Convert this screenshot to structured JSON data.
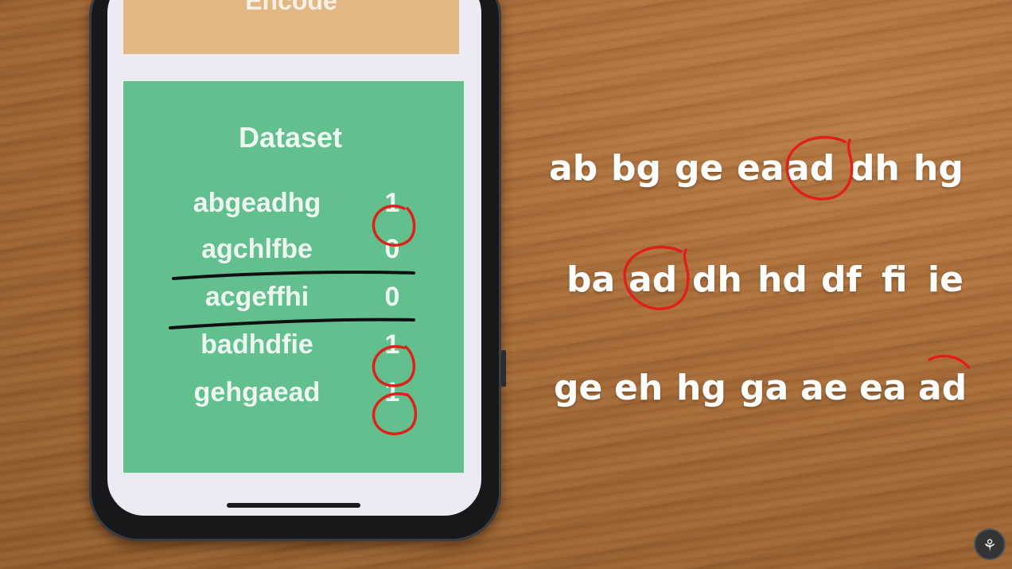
{
  "phone": {
    "encode_button_label": "Encode",
    "dataset_title": "Dataset",
    "rows": [
      {
        "sequence": "abgeadhg",
        "label": "1",
        "circled": true,
        "struck": false
      },
      {
        "sequence": "agchlfbe",
        "label": "0",
        "circled": false,
        "struck": true
      },
      {
        "sequence": "acgeffhi",
        "label": "0",
        "circled": false,
        "struck": true
      },
      {
        "sequence": "badhdfie",
        "label": "1",
        "circled": true,
        "struck": false
      },
      {
        "sequence": "gehgaead",
        "label": "1",
        "circled": true,
        "struck": false
      }
    ]
  },
  "pair_lines": [
    {
      "pairs": [
        "ab",
        "bg",
        "ge",
        "ea",
        "ad",
        "dh",
        "hg"
      ],
      "circled_index": 4
    },
    {
      "pairs": [
        "ba",
        "ad",
        "dh",
        "hd",
        "df",
        "fi",
        "ie"
      ],
      "circled_index": 1
    },
    {
      "pairs": [
        "ge",
        "eh",
        "hg",
        "ga",
        "ae",
        "ea",
        "ad"
      ],
      "circled_index": 6,
      "circle_partial": true
    }
  ],
  "annotation_color": "#e0201a",
  "dataset_green": "#62bf8e",
  "encode_orange": "#e3b784",
  "corner_logo_icon": "lightbulb-logo-icon"
}
